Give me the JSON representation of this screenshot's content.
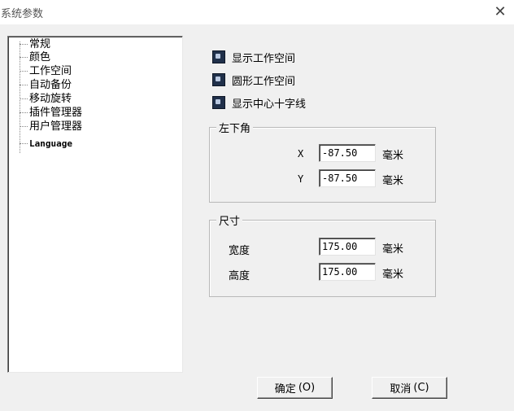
{
  "window": {
    "title": "系统参数",
    "close_glyph": "✕"
  },
  "tree": {
    "items": [
      {
        "label": "常规"
      },
      {
        "label": "颜色"
      },
      {
        "label": "工作空间"
      },
      {
        "label": "自动备份"
      },
      {
        "label": "移动旋转"
      },
      {
        "label": "插件管理器"
      },
      {
        "label": "用户管理器"
      },
      {
        "label": "Language"
      }
    ]
  },
  "options": [
    {
      "label": "显示工作空间",
      "icon": "display-option-icon"
    },
    {
      "label": "圆形工作空间",
      "icon": "display-option-icon"
    },
    {
      "label": "显示中心十字线",
      "icon": "display-option-icon"
    }
  ],
  "bottom_left": {
    "title": "左下角",
    "x_label": "X",
    "x_value": "-87.50",
    "y_label": "Y",
    "y_value": "-87.50",
    "unit": "毫米"
  },
  "size": {
    "title": "尺寸",
    "width_label": "宽度",
    "width_value": "175.00",
    "height_label": "高度",
    "height_value": "175.00",
    "unit": "毫米"
  },
  "buttons": {
    "ok_label": "确定",
    "ok_accel": "(O)",
    "cancel_label": "取消",
    "cancel_accel": "(C)"
  }
}
